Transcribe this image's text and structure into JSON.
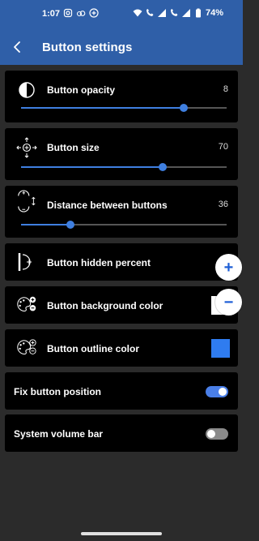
{
  "status": {
    "time": "1:07",
    "battery": "74%",
    "left_icons": [
      "instagram-icon",
      "cloud-icon",
      "plus-circle-icon"
    ],
    "right_icons": [
      "wifi-icon",
      "wifi-call-icon",
      "signal-icon",
      "wifi-call-icon",
      "signal-icon",
      "battery-icon"
    ]
  },
  "appbar": {
    "back_icon": "back-arrow-icon",
    "title": "Button settings"
  },
  "settings": {
    "opacity": {
      "label": "Button opacity",
      "value": "8",
      "level": 0.79,
      "icon": "half-circle-icon"
    },
    "size": {
      "label": "Button size",
      "value": "70",
      "level": 0.69,
      "icon": "move-arrows-icon"
    },
    "distance": {
      "label": "Distance between buttons",
      "value": "36",
      "level": 0.24,
      "icon": "distance-icon"
    },
    "hidden": {
      "label": "Button hidden percent",
      "icon": "hidden-percent-icon"
    },
    "bg_color": {
      "label": "Button background color",
      "swatch_color": "#ffffff",
      "icon": "palette-icon"
    },
    "outline_color": {
      "label": "Button outline color",
      "swatch_color": "#2f7cf0",
      "icon": "palette-icon"
    },
    "fix_position": {
      "label": "Fix button position",
      "on": true,
      "accent": "#4a7fe8"
    },
    "volume_bar": {
      "label": "System volume bar",
      "on": false
    }
  },
  "floating": {
    "plus_label": "+",
    "minus_label": "−"
  },
  "colors": {
    "primary": "#2f5fa8",
    "accent": "#3f7fe0",
    "background": "#2b2b2b",
    "card": "#000000"
  }
}
